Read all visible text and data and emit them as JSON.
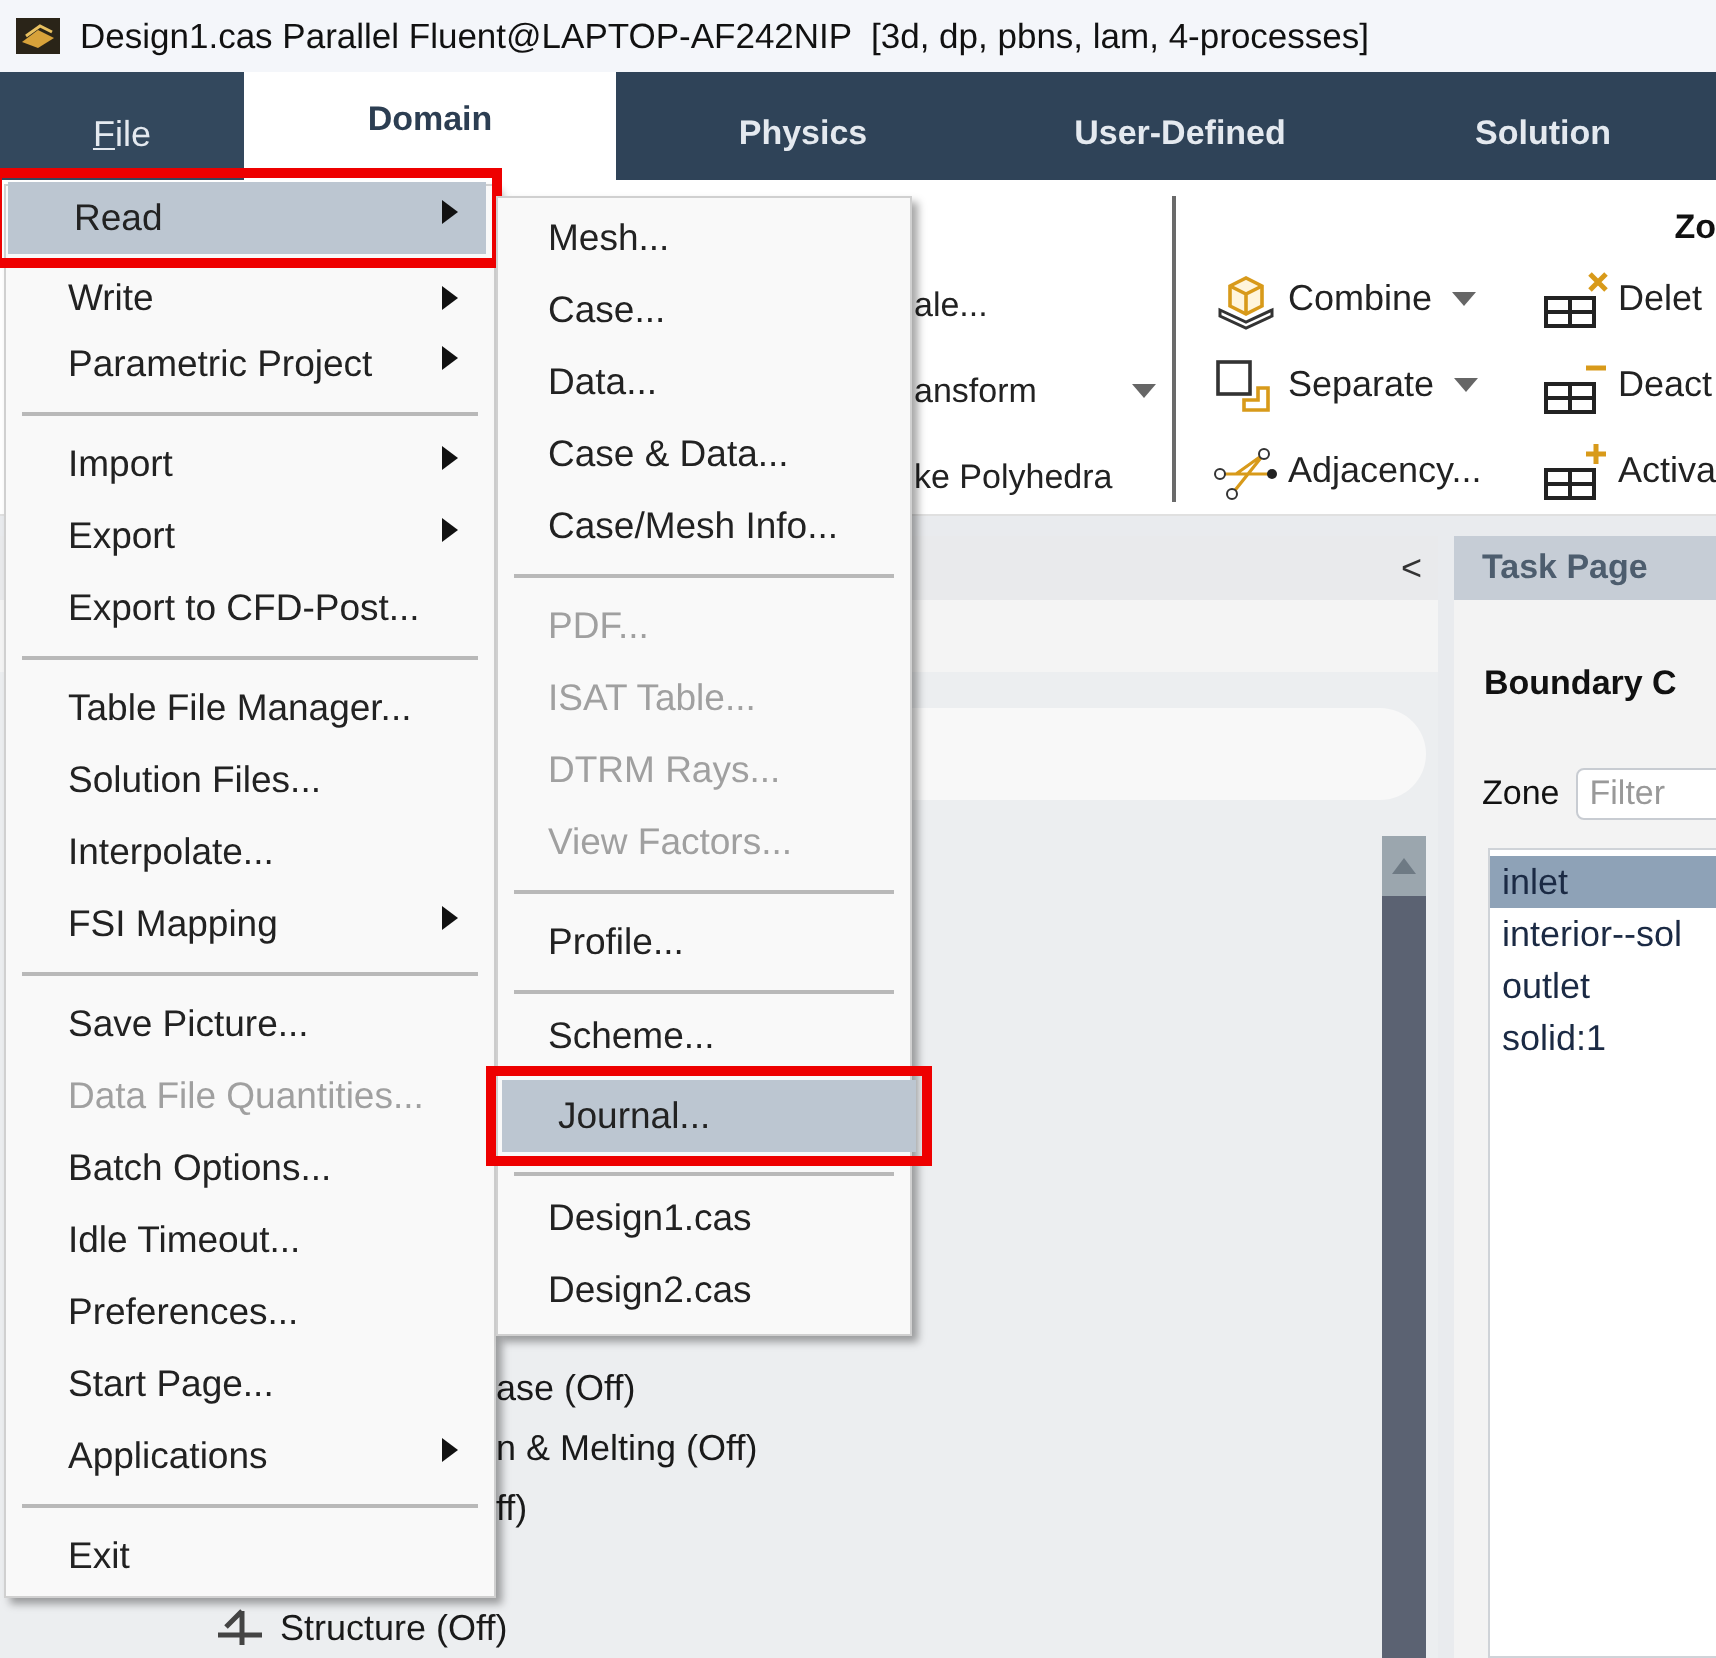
{
  "window": {
    "title": "Design1.cas Parallel Fluent@LAPTOP-AF242NIP  [3d, dp, pbns, lam, 4-processes]"
  },
  "tabs": [
    {
      "label": "File",
      "selected": false,
      "kind": "file"
    },
    {
      "label": "Domain",
      "selected": true,
      "kind": "ribbon"
    },
    {
      "label": "Physics",
      "selected": false,
      "kind": "ribbon"
    },
    {
      "label": "User-Defined",
      "selected": false,
      "kind": "ribbon"
    },
    {
      "label": "Solution",
      "selected": false,
      "kind": "ribbon"
    }
  ],
  "ribbon": {
    "partial_commands": [
      {
        "label": "ale..."
      },
      {
        "label": "ansform",
        "dropdown": true
      },
      {
        "label": "ke Polyhedra"
      }
    ],
    "zone_group": {
      "title": "Zo",
      "commands": [
        {
          "label": "Combine",
          "dropdown": true
        },
        {
          "label": "Delet"
        },
        {
          "label": "Separate",
          "dropdown": true
        },
        {
          "label": "Deact"
        },
        {
          "label": "Adjacency..."
        },
        {
          "label": "Activa"
        }
      ]
    }
  },
  "outline_panel": {
    "collapse": "<",
    "tree": [
      {
        "label": "ase (Off)",
        "kind": "clipped"
      },
      {
        "label": "n & Melting (Off)",
        "kind": "clipped"
      },
      {
        "label": "ff)",
        "kind": "clipped"
      },
      {
        "label": "Structure (Off)",
        "kind": "item"
      }
    ]
  },
  "task_page": {
    "title": "Task Page",
    "heading": "Boundary C",
    "zone_label": "Zone",
    "filter": {
      "placeholder": "Filter"
    },
    "zones": [
      {
        "label": "inlet",
        "selected": true
      },
      {
        "label": "interior--sol",
        "selected": false
      },
      {
        "label": "outlet",
        "selected": false
      },
      {
        "label": "solid:1",
        "selected": false
      }
    ]
  },
  "file_menu": {
    "items": [
      {
        "kind": "item",
        "label": "Read",
        "submenu": true,
        "selected": true,
        "highlighted": true,
        "disabled": false
      },
      {
        "kind": "item",
        "label": "Write",
        "submenu": true,
        "selected": false,
        "highlighted": false,
        "disabled": false
      },
      {
        "kind": "item",
        "label": "Parametric Project",
        "submenu": true,
        "selected": false,
        "highlighted": false,
        "disabled": false
      },
      {
        "kind": "separator"
      },
      {
        "kind": "item",
        "label": "Import",
        "submenu": true,
        "selected": false,
        "highlighted": false,
        "disabled": false
      },
      {
        "kind": "item",
        "label": "Export",
        "submenu": true,
        "selected": false,
        "highlighted": false,
        "disabled": false
      },
      {
        "kind": "item",
        "label": "Export to CFD-Post...",
        "submenu": false,
        "selected": false,
        "highlighted": false,
        "disabled": false
      },
      {
        "kind": "separator"
      },
      {
        "kind": "item",
        "label": "Table File Manager...",
        "submenu": false,
        "selected": false,
        "highlighted": false,
        "disabled": false
      },
      {
        "kind": "item",
        "label": "Solution Files...",
        "submenu": false,
        "selected": false,
        "highlighted": false,
        "disabled": false
      },
      {
        "kind": "item",
        "label": "Interpolate...",
        "submenu": false,
        "selected": false,
        "highlighted": false,
        "disabled": false
      },
      {
        "kind": "item",
        "label": "FSI Mapping",
        "submenu": true,
        "selected": false,
        "highlighted": false,
        "disabled": false
      },
      {
        "kind": "separator"
      },
      {
        "kind": "item",
        "label": "Save Picture...",
        "submenu": false,
        "selected": false,
        "highlighted": false,
        "disabled": false
      },
      {
        "kind": "item",
        "label": "Data File Quantities...",
        "submenu": false,
        "selected": false,
        "highlighted": false,
        "disabled": true
      },
      {
        "kind": "item",
        "label": "Batch Options...",
        "submenu": false,
        "selected": false,
        "highlighted": false,
        "disabled": false
      },
      {
        "kind": "item",
        "label": "Idle Timeout...",
        "submenu": false,
        "selected": false,
        "highlighted": false,
        "disabled": false
      },
      {
        "kind": "item",
        "label": "Preferences...",
        "submenu": false,
        "selected": false,
        "highlighted": false,
        "disabled": false
      },
      {
        "kind": "item",
        "label": "Start Page...",
        "submenu": false,
        "selected": false,
        "highlighted": false,
        "disabled": false
      },
      {
        "kind": "item",
        "label": "Applications",
        "submenu": true,
        "selected": false,
        "highlighted": false,
        "disabled": false
      },
      {
        "kind": "separator"
      },
      {
        "kind": "item",
        "label": "Exit",
        "submenu": false,
        "selected": false,
        "highlighted": false,
        "disabled": false
      }
    ]
  },
  "read_submenu": {
    "items": [
      {
        "kind": "item",
        "label": "Mesh...",
        "submenu": false,
        "selected": false,
        "highlighted": false,
        "disabled": false
      },
      {
        "kind": "item",
        "label": "Case...",
        "submenu": false,
        "selected": false,
        "highlighted": false,
        "disabled": false
      },
      {
        "kind": "item",
        "label": "Data...",
        "submenu": false,
        "selected": false,
        "highlighted": false,
        "disabled": false
      },
      {
        "kind": "item",
        "label": "Case & Data...",
        "submenu": false,
        "selected": false,
        "highlighted": false,
        "disabled": false
      },
      {
        "kind": "item",
        "label": "Case/Mesh Info...",
        "submenu": false,
        "selected": false,
        "highlighted": false,
        "disabled": false
      },
      {
        "kind": "separator"
      },
      {
        "kind": "item",
        "label": "PDF...",
        "submenu": false,
        "selected": false,
        "highlighted": false,
        "disabled": true
      },
      {
        "kind": "item",
        "label": "ISAT Table...",
        "submenu": false,
        "selected": false,
        "highlighted": false,
        "disabled": true
      },
      {
        "kind": "item",
        "label": "DTRM Rays...",
        "submenu": false,
        "selected": false,
        "highlighted": false,
        "disabled": true
      },
      {
        "kind": "item",
        "label": "View Factors...",
        "submenu": false,
        "selected": false,
        "highlighted": false,
        "disabled": true
      },
      {
        "kind": "separator"
      },
      {
        "kind": "item",
        "label": "Profile...",
        "submenu": false,
        "selected": false,
        "highlighted": false,
        "disabled": false
      },
      {
        "kind": "separator"
      },
      {
        "kind": "item",
        "label": "Scheme...",
        "submenu": false,
        "selected": false,
        "highlighted": false,
        "disabled": false
      },
      {
        "kind": "item",
        "label": "Journal...",
        "submenu": false,
        "selected": true,
        "highlighted": true,
        "disabled": false
      },
      {
        "kind": "separator"
      },
      {
        "kind": "item",
        "label": "Design1.cas",
        "submenu": false,
        "selected": false,
        "highlighted": false,
        "disabled": false
      },
      {
        "kind": "item",
        "label": "Design2.cas",
        "submenu": false,
        "selected": false,
        "highlighted": false,
        "disabled": false
      }
    ]
  }
}
